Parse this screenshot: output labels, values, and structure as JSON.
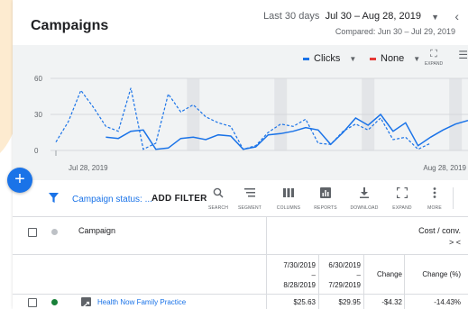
{
  "header": {
    "title": "Campaigns",
    "date_prefix": "Last 30 days",
    "date_range": "Jul 30 – Aug 28, 2019",
    "compared": "Compared: Jun 30 – Jul 29, 2019"
  },
  "chart_controls": {
    "metric1": "Clicks",
    "metric2": "None",
    "expand_label": "EXPAND"
  },
  "colors": {
    "accent": "#1a73e8",
    "metric2": "#e53935",
    "status_green": "#188038"
  },
  "chart_data": {
    "type": "line",
    "ylim": [
      0,
      60
    ],
    "y_ticks": [
      "0",
      "30",
      "60"
    ],
    "x_start_label": "Jul 28, 2019",
    "x_end_label": "Aug 28, 2019",
    "shaded_days": [
      11,
      18,
      25,
      32
    ],
    "series": [
      {
        "style": "solid",
        "values": [
          null,
          null,
          null,
          null,
          11,
          10,
          16,
          17,
          1,
          2,
          10,
          11,
          9,
          13,
          12,
          1,
          3,
          13,
          14,
          16,
          19,
          17,
          5,
          15,
          27,
          21,
          30,
          16,
          23,
          4,
          11,
          17,
          22,
          25
        ]
      },
      {
        "style": "dashed",
        "values": [
          7,
          24,
          50,
          36,
          20,
          16,
          52,
          1,
          6,
          47,
          32,
          38,
          28,
          23,
          20,
          1,
          4,
          15,
          22,
          20,
          26,
          6,
          5,
          16,
          22,
          17,
          27,
          9,
          11,
          1,
          6,
          null,
          null,
          null
        ]
      }
    ]
  },
  "fab": {
    "label": "+"
  },
  "toolbar": {
    "filter_text": "Campaign status: ...",
    "add_filter": "ADD FILTER",
    "tools": [
      {
        "icon": "search-icon",
        "label": "SEARCH"
      },
      {
        "icon": "segment-icon",
        "label": "SEGMENT"
      },
      {
        "icon": "columns-icon",
        "label": "COLUMNS"
      },
      {
        "icon": "reports-icon",
        "label": "REPORTS"
      },
      {
        "icon": "download-icon",
        "label": "DOWNLOAD"
      },
      {
        "icon": "expand-icon",
        "label": "EXPAND"
      },
      {
        "icon": "more-icon",
        "label": "MORE"
      }
    ]
  },
  "table": {
    "campaign_header": "Campaign",
    "cost_header": "Cost / conv.",
    "cost_arrows": "> <",
    "sub_headers": {
      "current_start": "7/30/2019",
      "current_dash": "–",
      "current_end": "8/28/2019",
      "prior_start": "6/30/2019",
      "prior_dash": "–",
      "prior_end": "7/29/2019",
      "change": "Change",
      "change_pct": "Change (%)"
    },
    "rows": [
      {
        "campaign": "Health Now Family Practice",
        "current": "$25.63",
        "prior": "$29.95",
        "change": "-$4.32",
        "change_pct": "-14.43%"
      }
    ]
  }
}
